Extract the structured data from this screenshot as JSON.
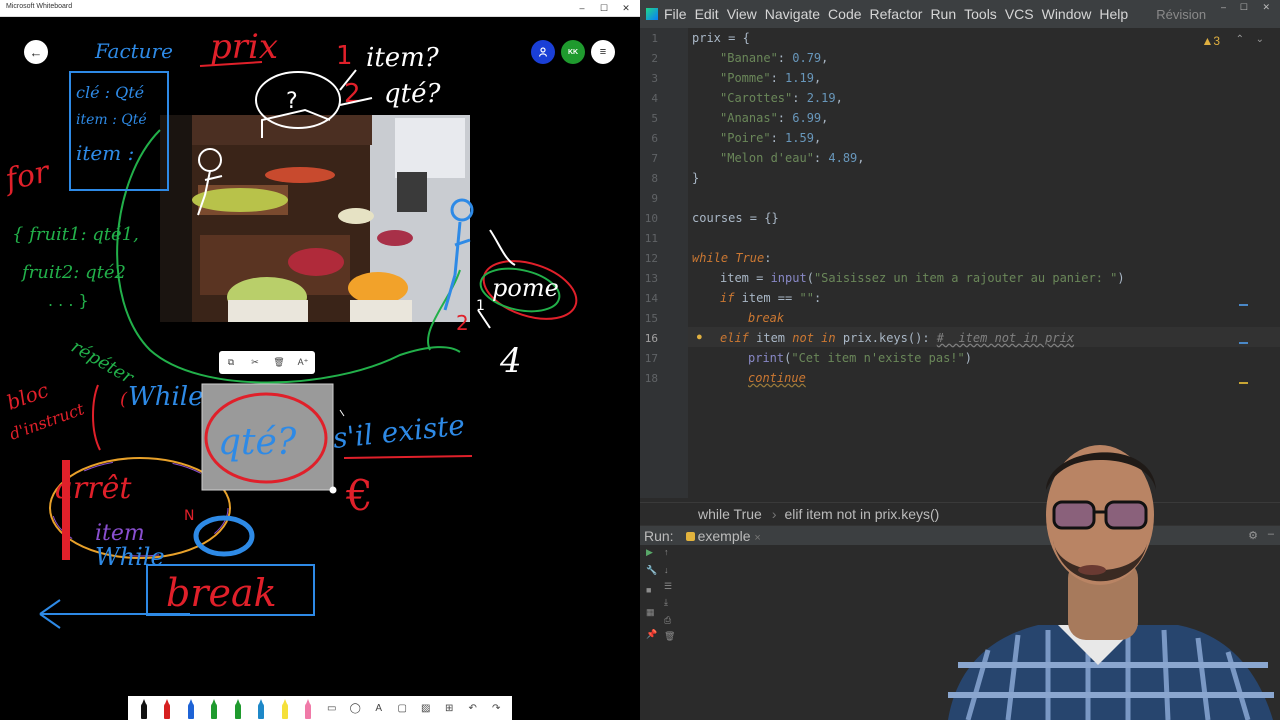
{
  "whiteboard": {
    "window_title": "Microsoft Whiteboard",
    "controls": {
      "minimize": "–",
      "maximize": "☐",
      "close": "✕"
    },
    "top_buttons": {
      "back_icon": "←",
      "user_icon": "person-icon",
      "avatar_initials": "KK",
      "menu_icon": "≡"
    },
    "context_toolbar": {
      "copy": "⧉",
      "cut": "✂",
      "delete": "🗑",
      "ink_to_text": "A⁺"
    },
    "pen_toolbar": {
      "pens": [
        "#111111",
        "#d62020",
        "#1e63d6",
        "#1f9a2e",
        "#1f9a2e",
        "#1e88c8",
        "#f5e03a",
        "#f07aa8"
      ],
      "tools": [
        "ruler",
        "lasso",
        "text",
        "sticky",
        "image",
        "insert",
        "undo",
        "redo"
      ],
      "tool_glyphs": [
        "▭",
        "◯",
        "A",
        "▢",
        "▨",
        "⊞",
        "↶",
        "↷"
      ]
    },
    "colors": {
      "red": "#e0202a",
      "blue": "#2e8ae6",
      "green": "#22b04a",
      "white": "#ffffff",
      "selection": "#9a9a9a"
    }
  },
  "ide": {
    "menu": [
      "File",
      "Edit",
      "View",
      "Navigate",
      "Code",
      "Refactor",
      "Run",
      "Tools",
      "VCS",
      "Window",
      "Help"
    ],
    "menu_extra": "Révision",
    "warnings": "▲3",
    "code": {
      "l1": {
        "num": "1",
        "a": "prix = {"
      },
      "l2": {
        "num": "2",
        "k": "\"Banane\"",
        "v": "0.79"
      },
      "l3": {
        "num": "3",
        "k": "\"Pomme\"",
        "v": "1.19"
      },
      "l4": {
        "num": "4",
        "k": "\"Carottes\"",
        "v": "2.19"
      },
      "l5": {
        "num": "5",
        "k": "\"Ananas\"",
        "v": "6.99"
      },
      "l6": {
        "num": "6",
        "k": "\"Poire\"",
        "v": "1.59"
      },
      "l7": {
        "num": "7",
        "k": "\"Melon d'eau\"",
        "v": "4.89"
      },
      "l8": {
        "num": "8",
        "a": "}"
      },
      "l9": {
        "num": "9"
      },
      "l10": {
        "num": "10",
        "a": "courses = {}"
      },
      "l11": {
        "num": "11"
      },
      "l12": {
        "num": "12",
        "kw": "while",
        "kw2": "True",
        "rest": ":"
      },
      "l13": {
        "num": "13",
        "a": "item = ",
        "fn": "input",
        "str": "\"Saisissez un item a rajouter au panier: \""
      },
      "l14": {
        "num": "14",
        "kw": "if",
        "a": " item == ",
        "str": "\"\"",
        "rest": ":"
      },
      "l15": {
        "num": "15",
        "kw": "break"
      },
      "l16": {
        "num": "16",
        "kw": "elif",
        "a": " item ",
        "kw2": "not in",
        "b": " prix.keys():",
        "cmt": "#  item not in prix"
      },
      "l17": {
        "num": "17",
        "fn": "print",
        "str": "\"Cet item n'existe pas!\""
      },
      "l18": {
        "num": "18",
        "kw": "continue"
      }
    },
    "breadcrumbs": [
      "while True",
      "elif item not in prix.keys()"
    ],
    "run": {
      "label": "Run:",
      "config": "exemple",
      "close": "×",
      "settings_icon": "⚙",
      "hide_icon": "–"
    }
  }
}
